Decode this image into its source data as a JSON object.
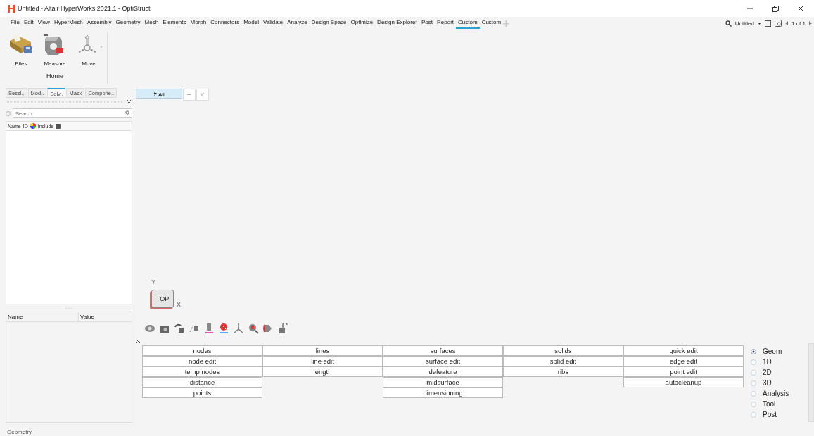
{
  "window": {
    "title": "Untitled - Altair HyperWorks 2021.1 - OptiStruct"
  },
  "menu": [
    {
      "label": "File",
      "selected": false
    },
    {
      "label": "Edit",
      "selected": false
    },
    {
      "label": "View",
      "selected": false
    },
    {
      "label": "HyperMesh",
      "selected": false
    },
    {
      "label": "Assembly",
      "selected": false
    },
    {
      "label": "Geometry",
      "selected": false
    },
    {
      "label": "Mesh",
      "selected": false
    },
    {
      "label": "Elements",
      "selected": false
    },
    {
      "label": "Morph",
      "selected": false
    },
    {
      "label": "Connectors",
      "selected": false
    },
    {
      "label": "Model",
      "selected": false
    },
    {
      "label": "Validate",
      "selected": false
    },
    {
      "label": "Analyze",
      "selected": false
    },
    {
      "label": "Design Space",
      "selected": false
    },
    {
      "label": "Optimize",
      "selected": false
    },
    {
      "label": "Design Explorer",
      "selected": false
    },
    {
      "label": "Post",
      "selected": false
    },
    {
      "label": "Report",
      "selected": false
    },
    {
      "label": "Custom",
      "selected": true
    },
    {
      "label": "Custom",
      "selected": false
    }
  ],
  "menu_right": {
    "model": "Untitled",
    "pages": "1 of 1"
  },
  "ribbon": {
    "tools": [
      {
        "label": "Files",
        "kind": "files"
      },
      {
        "label": "Measure",
        "kind": "measure"
      },
      {
        "label": "Move",
        "kind": "move"
      }
    ],
    "group": "Home"
  },
  "browser_tabs": [
    {
      "label": "Sessi..",
      "selected": false
    },
    {
      "label": "Mod..",
      "selected": false
    },
    {
      "label": "Solv..",
      "selected": true
    },
    {
      "label": "Mask",
      "selected": false
    },
    {
      "label": "Compone..",
      "selected": false
    }
  ],
  "search": {
    "placeholder": "Search"
  },
  "entity_columns": [
    "Name",
    "ID",
    "Include"
  ],
  "filter": {
    "label": "All",
    "selected": true
  },
  "properties": {
    "columns": [
      "Name",
      "Value"
    ]
  },
  "axes": {
    "y": "Y",
    "x": "X",
    "cube": "TOP"
  },
  "panel": {
    "columns": [
      [
        "nodes",
        "node edit",
        "temp nodes",
        "distance",
        "points"
      ],
      [
        "lines",
        "line edit",
        "length"
      ],
      [
        "surfaces",
        "surface edit",
        "defeature",
        "midsurface",
        "dimensioning"
      ],
      [
        "solids",
        "solid edit",
        "ribs"
      ],
      [
        "quick edit",
        "edge edit",
        "point edit",
        "autocleanup"
      ]
    ]
  },
  "page_options": [
    {
      "label": "Geom",
      "selected": true
    },
    {
      "label": "1D",
      "selected": false
    },
    {
      "label": "2D",
      "selected": false
    },
    {
      "label": "3D",
      "selected": false
    },
    {
      "label": "Analysis",
      "selected": false
    },
    {
      "label": "Tool",
      "selected": false
    },
    {
      "label": "Post",
      "selected": false
    }
  ],
  "status_bar": "Geometry"
}
